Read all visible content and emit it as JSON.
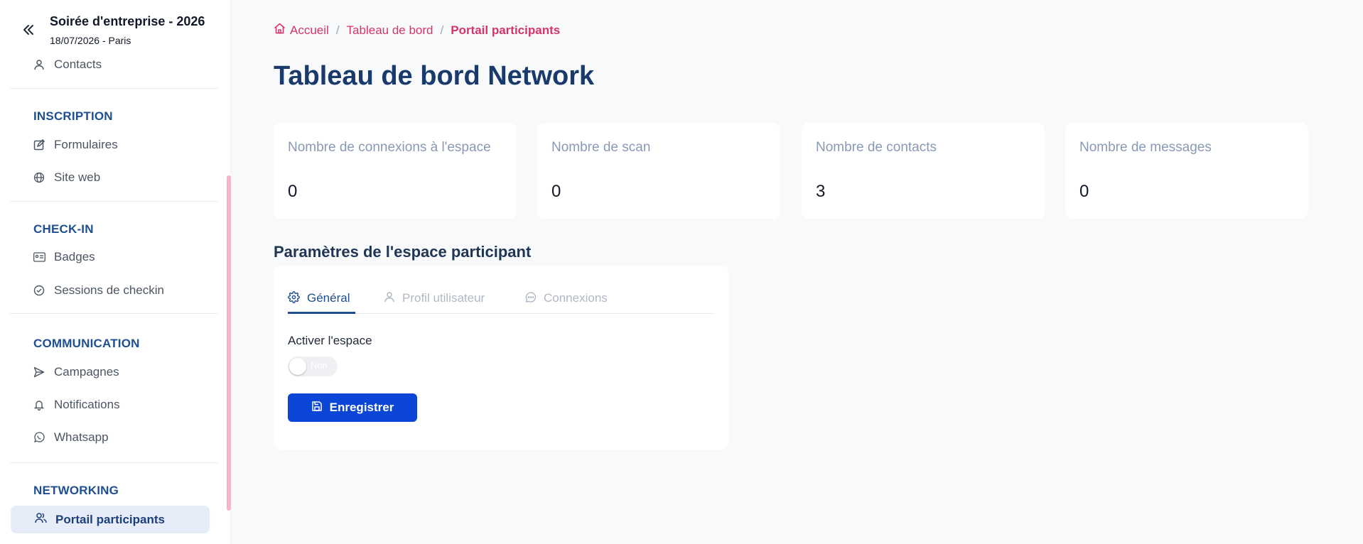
{
  "event": {
    "title": "Soirée d'entreprise - 2026",
    "subtitle": "18/07/2026 - Paris"
  },
  "sidebar": {
    "contacts": "Contacts",
    "sections": {
      "inscription": "INSCRIPTION",
      "checkin": "CHECK-IN",
      "communication": "COMMUNICATION",
      "networking": "NETWORKING"
    },
    "items": {
      "formulaires": "Formulaires",
      "site_web": "Site web",
      "badges": "Badges",
      "sessions": "Sessions de checkin",
      "campagnes": "Campagnes",
      "notifications": "Notifications",
      "whatsapp": "Whatsapp",
      "portail": "Portail participants"
    }
  },
  "breadcrumb": {
    "home": "Accueil",
    "dashboard": "Tableau de bord",
    "current": "Portail participants"
  },
  "page_title": "Tableau de bord Network",
  "stats": [
    {
      "label": "Nombre de connexions à l'espace",
      "value": "0"
    },
    {
      "label": "Nombre de scan",
      "value": "0"
    },
    {
      "label": "Nombre de contacts",
      "value": "3"
    },
    {
      "label": "Nombre de messages",
      "value": "0"
    }
  ],
  "settings": {
    "title": "Paramètres de l'espace participant",
    "tabs": [
      "Général",
      "Profil utilisateur",
      "Connexions"
    ],
    "toggle_label": "Activer l'espace",
    "toggle_value": "Non",
    "save_label": "Enregistrer"
  },
  "colors": {
    "accent": "#d6336c",
    "primary": "#1d4f91",
    "button": "#0b46d6"
  }
}
